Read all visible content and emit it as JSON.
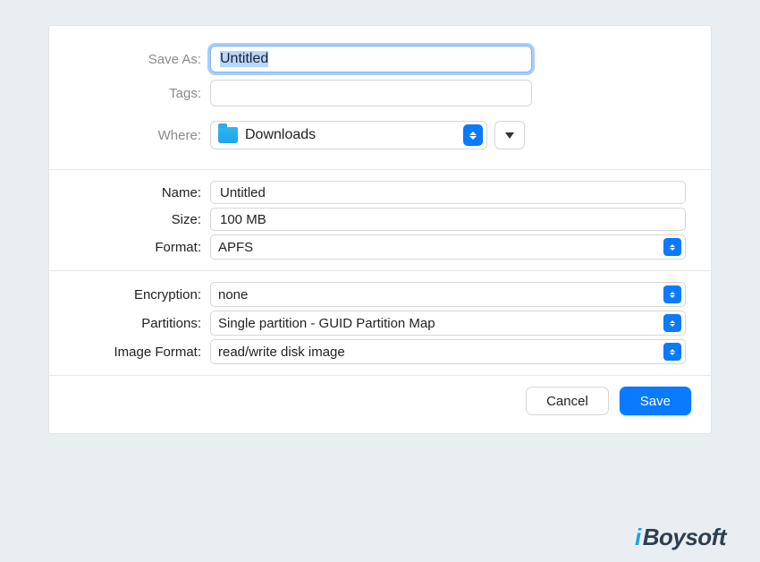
{
  "save_panel": {
    "save_as_label": "Save As:",
    "save_as_value": "Untitled",
    "tags_label": "Tags:",
    "tags_value": "",
    "where_label": "Where:",
    "where_value": "Downloads"
  },
  "disk_image": {
    "name_label": "Name:",
    "name_value": "Untitled",
    "size_label": "Size:",
    "size_value": "100 MB",
    "format_label": "Format:",
    "format_value": "APFS",
    "encryption_label": "Encryption:",
    "encryption_value": "none",
    "partitions_label": "Partitions:",
    "partitions_value": "Single partition - GUID Partition Map",
    "image_format_label": "Image Format:",
    "image_format_value": "read/write disk image"
  },
  "buttons": {
    "cancel": "Cancel",
    "save": "Save"
  },
  "watermark": "iBoysoft"
}
